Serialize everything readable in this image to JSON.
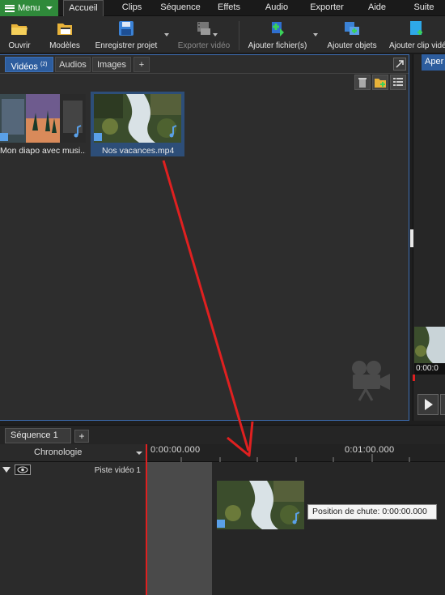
{
  "menubar": {
    "menu_label": "Menu",
    "tabs": [
      "Accueil",
      "Clips",
      "Séquence",
      "Effets",
      "Audio",
      "Exporter",
      "Aide",
      "Suite"
    ]
  },
  "toolbar": {
    "open": "Ouvrir",
    "templates": "Modèles",
    "save_project": "Enregistrer projet",
    "export_video": "Exporter vidéo",
    "add_files": "Ajouter fichier(s)",
    "add_objects": "Ajouter objets",
    "add_clip": "Ajouter clip vidé"
  },
  "media": {
    "tabs": [
      {
        "label": "Vidéos",
        "badge": "(2)"
      },
      {
        "label": "Audios"
      },
      {
        "label": "Images"
      },
      {
        "label": "+"
      }
    ],
    "items": [
      {
        "label": "Mon diapo avec musi..."
      },
      {
        "label": "Nos vacances.mp4"
      }
    ]
  },
  "right_panel": {
    "tab_label": "Aper",
    "time": "0:00:0"
  },
  "sequence": {
    "tab_label": "Séquence 1",
    "add_label": "+",
    "chrono_label": "Chronologie",
    "ruler_start": "0:00:00.000",
    "ruler_mid": "0:01:00.000",
    "track_label": "Piste vidéo 1",
    "tooltip": "Position de chute: 0:00:00.000"
  },
  "colors": {
    "accent_blue": "#2d5d9e",
    "menu_green": "#2f8a3a",
    "arrow_red": "#e02020",
    "playhead": "#e02020"
  }
}
